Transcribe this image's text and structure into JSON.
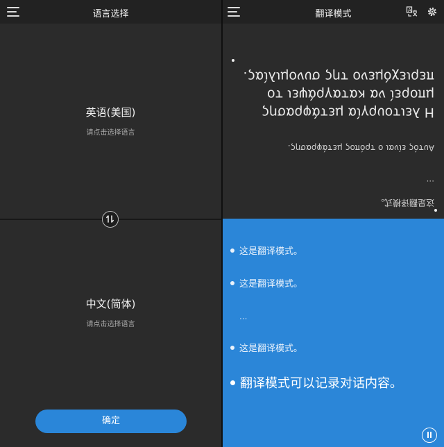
{
  "left": {
    "title": "语言选择",
    "source_lang": {
      "name": "英语(美国)",
      "hint": "请点击选择语言"
    },
    "target_lang": {
      "name": "中文(简体)",
      "hint": "请点击选择语言"
    },
    "confirm_label": "确定"
  },
  "right": {
    "title": "翻译模式",
    "mirrored": {
      "lines_big": [
        "Η λειτουργία μετάφρασης",
        "μπορεί να καταγράψει το",
        "περιεχόμενο της συνομιλίας."
      ],
      "line_mid": "Αυτός είναι ο τρόπος μετάφρασης.",
      "line_dots": "...",
      "line_small": "这是翻译模式。"
    },
    "chat": {
      "items": [
        "这是翻译模式。",
        "这是翻译模式。",
        "这是翻译模式。"
      ],
      "dots": "...",
      "big_item": "翻译模式可以记录对话内容。"
    }
  },
  "colors": {
    "accent": "#2a86d9",
    "panel_bg": "#2b2b2b",
    "chat_bg": "#2b86d8"
  },
  "icons": {
    "left_menu": "menu-icon",
    "swap": "swap-icon",
    "right_menu": "menu-icon",
    "translate": "translate-icon",
    "settings": "gear-icon",
    "pause": "pause-icon"
  }
}
